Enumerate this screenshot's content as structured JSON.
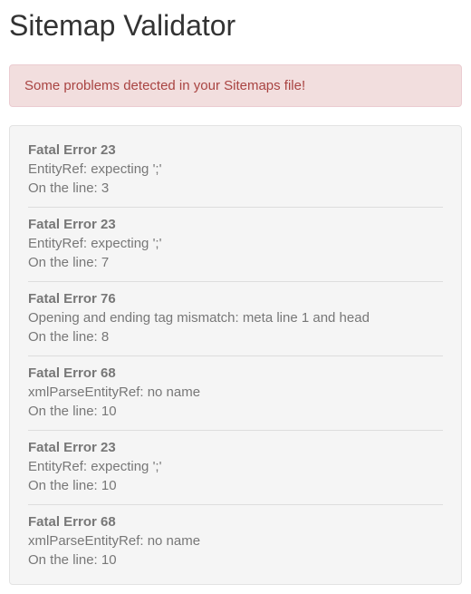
{
  "page_title": "Sitemap Validator",
  "alert_message": "Some problems detected in your Sitemaps file!",
  "errors": [
    {
      "title": "Fatal Error 23",
      "message": "EntityRef: expecting ';'",
      "line": "On the line: 3"
    },
    {
      "title": "Fatal Error 23",
      "message": "EntityRef: expecting ';'",
      "line": "On the line: 7"
    },
    {
      "title": "Fatal Error 76",
      "message": "Opening and ending tag mismatch: meta line 1 and head",
      "line": "On the line: 8"
    },
    {
      "title": "Fatal Error 68",
      "message": "xmlParseEntityRef: no name",
      "line": "On the line: 10"
    },
    {
      "title": "Fatal Error 23",
      "message": "EntityRef: expecting ';'",
      "line": "On the line: 10"
    },
    {
      "title": "Fatal Error 68",
      "message": "xmlParseEntityRef: no name",
      "line": "On the line: 10"
    }
  ]
}
